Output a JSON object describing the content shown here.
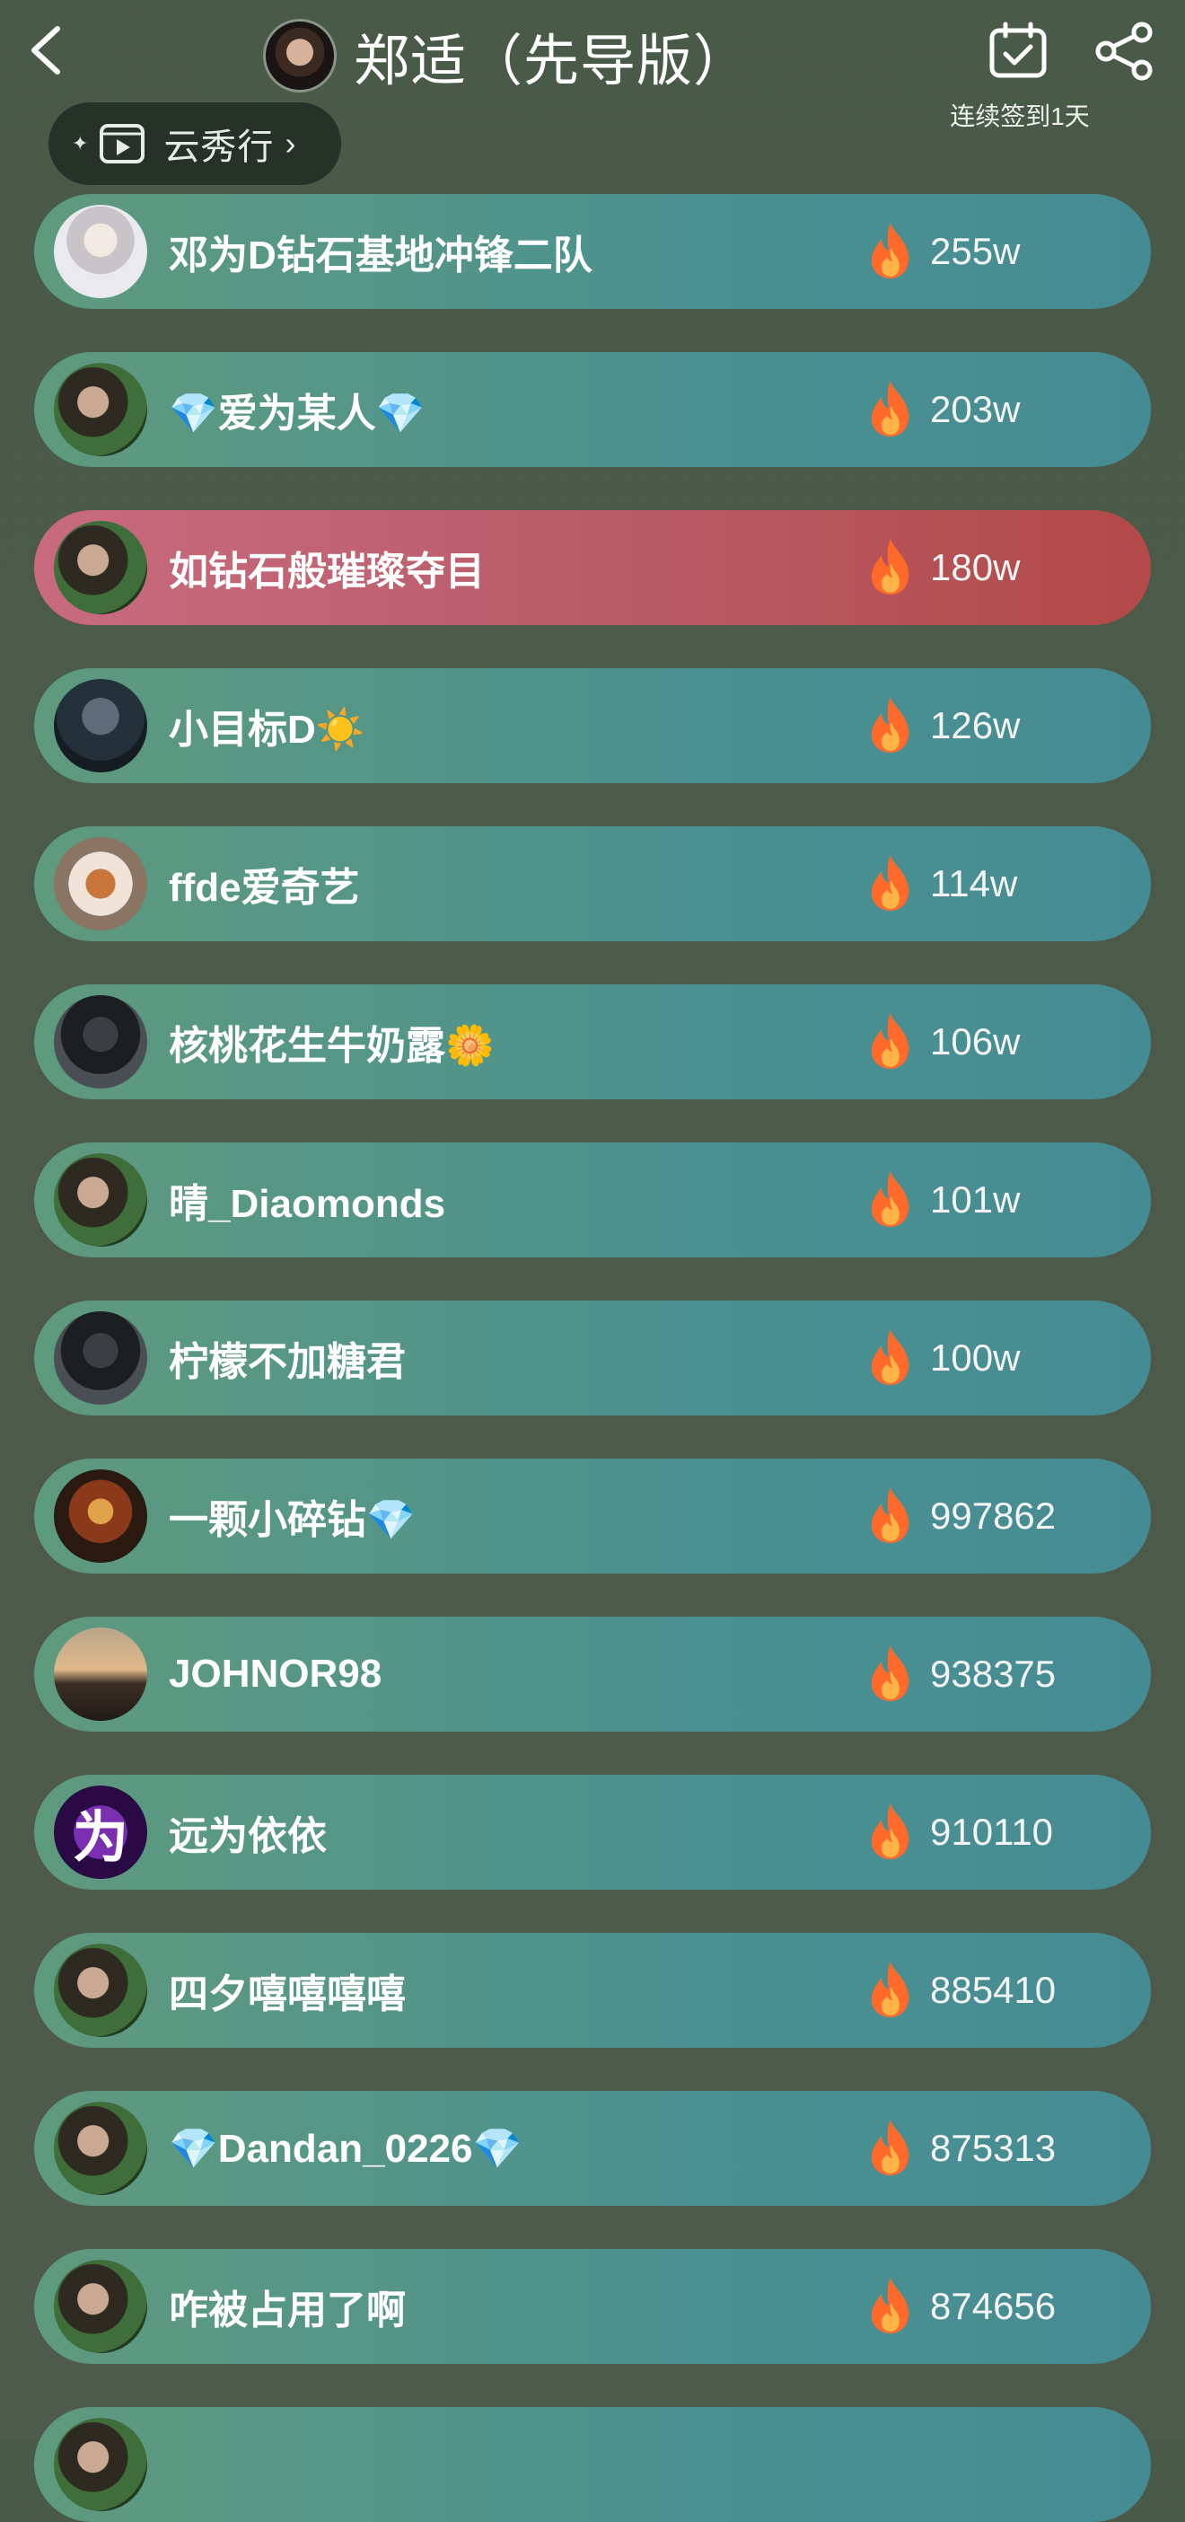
{
  "header": {
    "title": "郑适（先导版）",
    "checkin_label": "连续签到1天",
    "yunxiu_label": "云秀行",
    "yunxiu_spark": "✦",
    "yunxiu_chevron": "›"
  },
  "colors": {
    "background": "#4a5a48",
    "row_gradient_start": "#5e9a7e",
    "row_gradient_end": "#458b93",
    "highlight_start": "#c86b7f",
    "highlight_end": "#b34a48",
    "fire": "#ff6a2b"
  },
  "rankings": [
    {
      "name": "邓为D钻石基地冲锋二队",
      "score": "255w",
      "avatar": "av-grey",
      "highlight": false
    },
    {
      "name": "💎爱为某人💎",
      "score": "203w",
      "avatar": "av-green",
      "highlight": false
    },
    {
      "name": "如钻石般璀璨夺目",
      "score": "180w",
      "avatar": "av-green",
      "highlight": true
    },
    {
      "name": "小目标D☀️",
      "score": "126w",
      "avatar": "av-dark",
      "highlight": false
    },
    {
      "name": "ffde爱奇艺",
      "score": "114w",
      "avatar": "av-fox",
      "highlight": false
    },
    {
      "name": "核桃花生牛奶露🌼",
      "score": "106w",
      "avatar": "av-black",
      "highlight": false
    },
    {
      "name": "晴_Diaomonds",
      "score": "101w",
      "avatar": "av-green",
      "highlight": false
    },
    {
      "name": "柠檬不加糖君",
      "score": "100w",
      "avatar": "av-black",
      "highlight": false
    },
    {
      "name": "一颗小碎钻💎",
      "score": "997862",
      "avatar": "av-fire",
      "highlight": false
    },
    {
      "name": "JOHNOR98",
      "score": "938375",
      "avatar": "av-sunset",
      "highlight": false
    },
    {
      "name": "远为依依",
      "score": "910110",
      "avatar": "av-purple",
      "avatar_text": "为",
      "highlight": false
    },
    {
      "name": "四夕嘻嘻嘻嘻",
      "score": "885410",
      "avatar": "av-green",
      "highlight": false
    },
    {
      "name": "💎Dandan_0226💎",
      "score": "875313",
      "avatar": "av-green",
      "highlight": false
    },
    {
      "name": "咋被占用了啊",
      "score": "874656",
      "avatar": "av-green",
      "highlight": false
    }
  ]
}
